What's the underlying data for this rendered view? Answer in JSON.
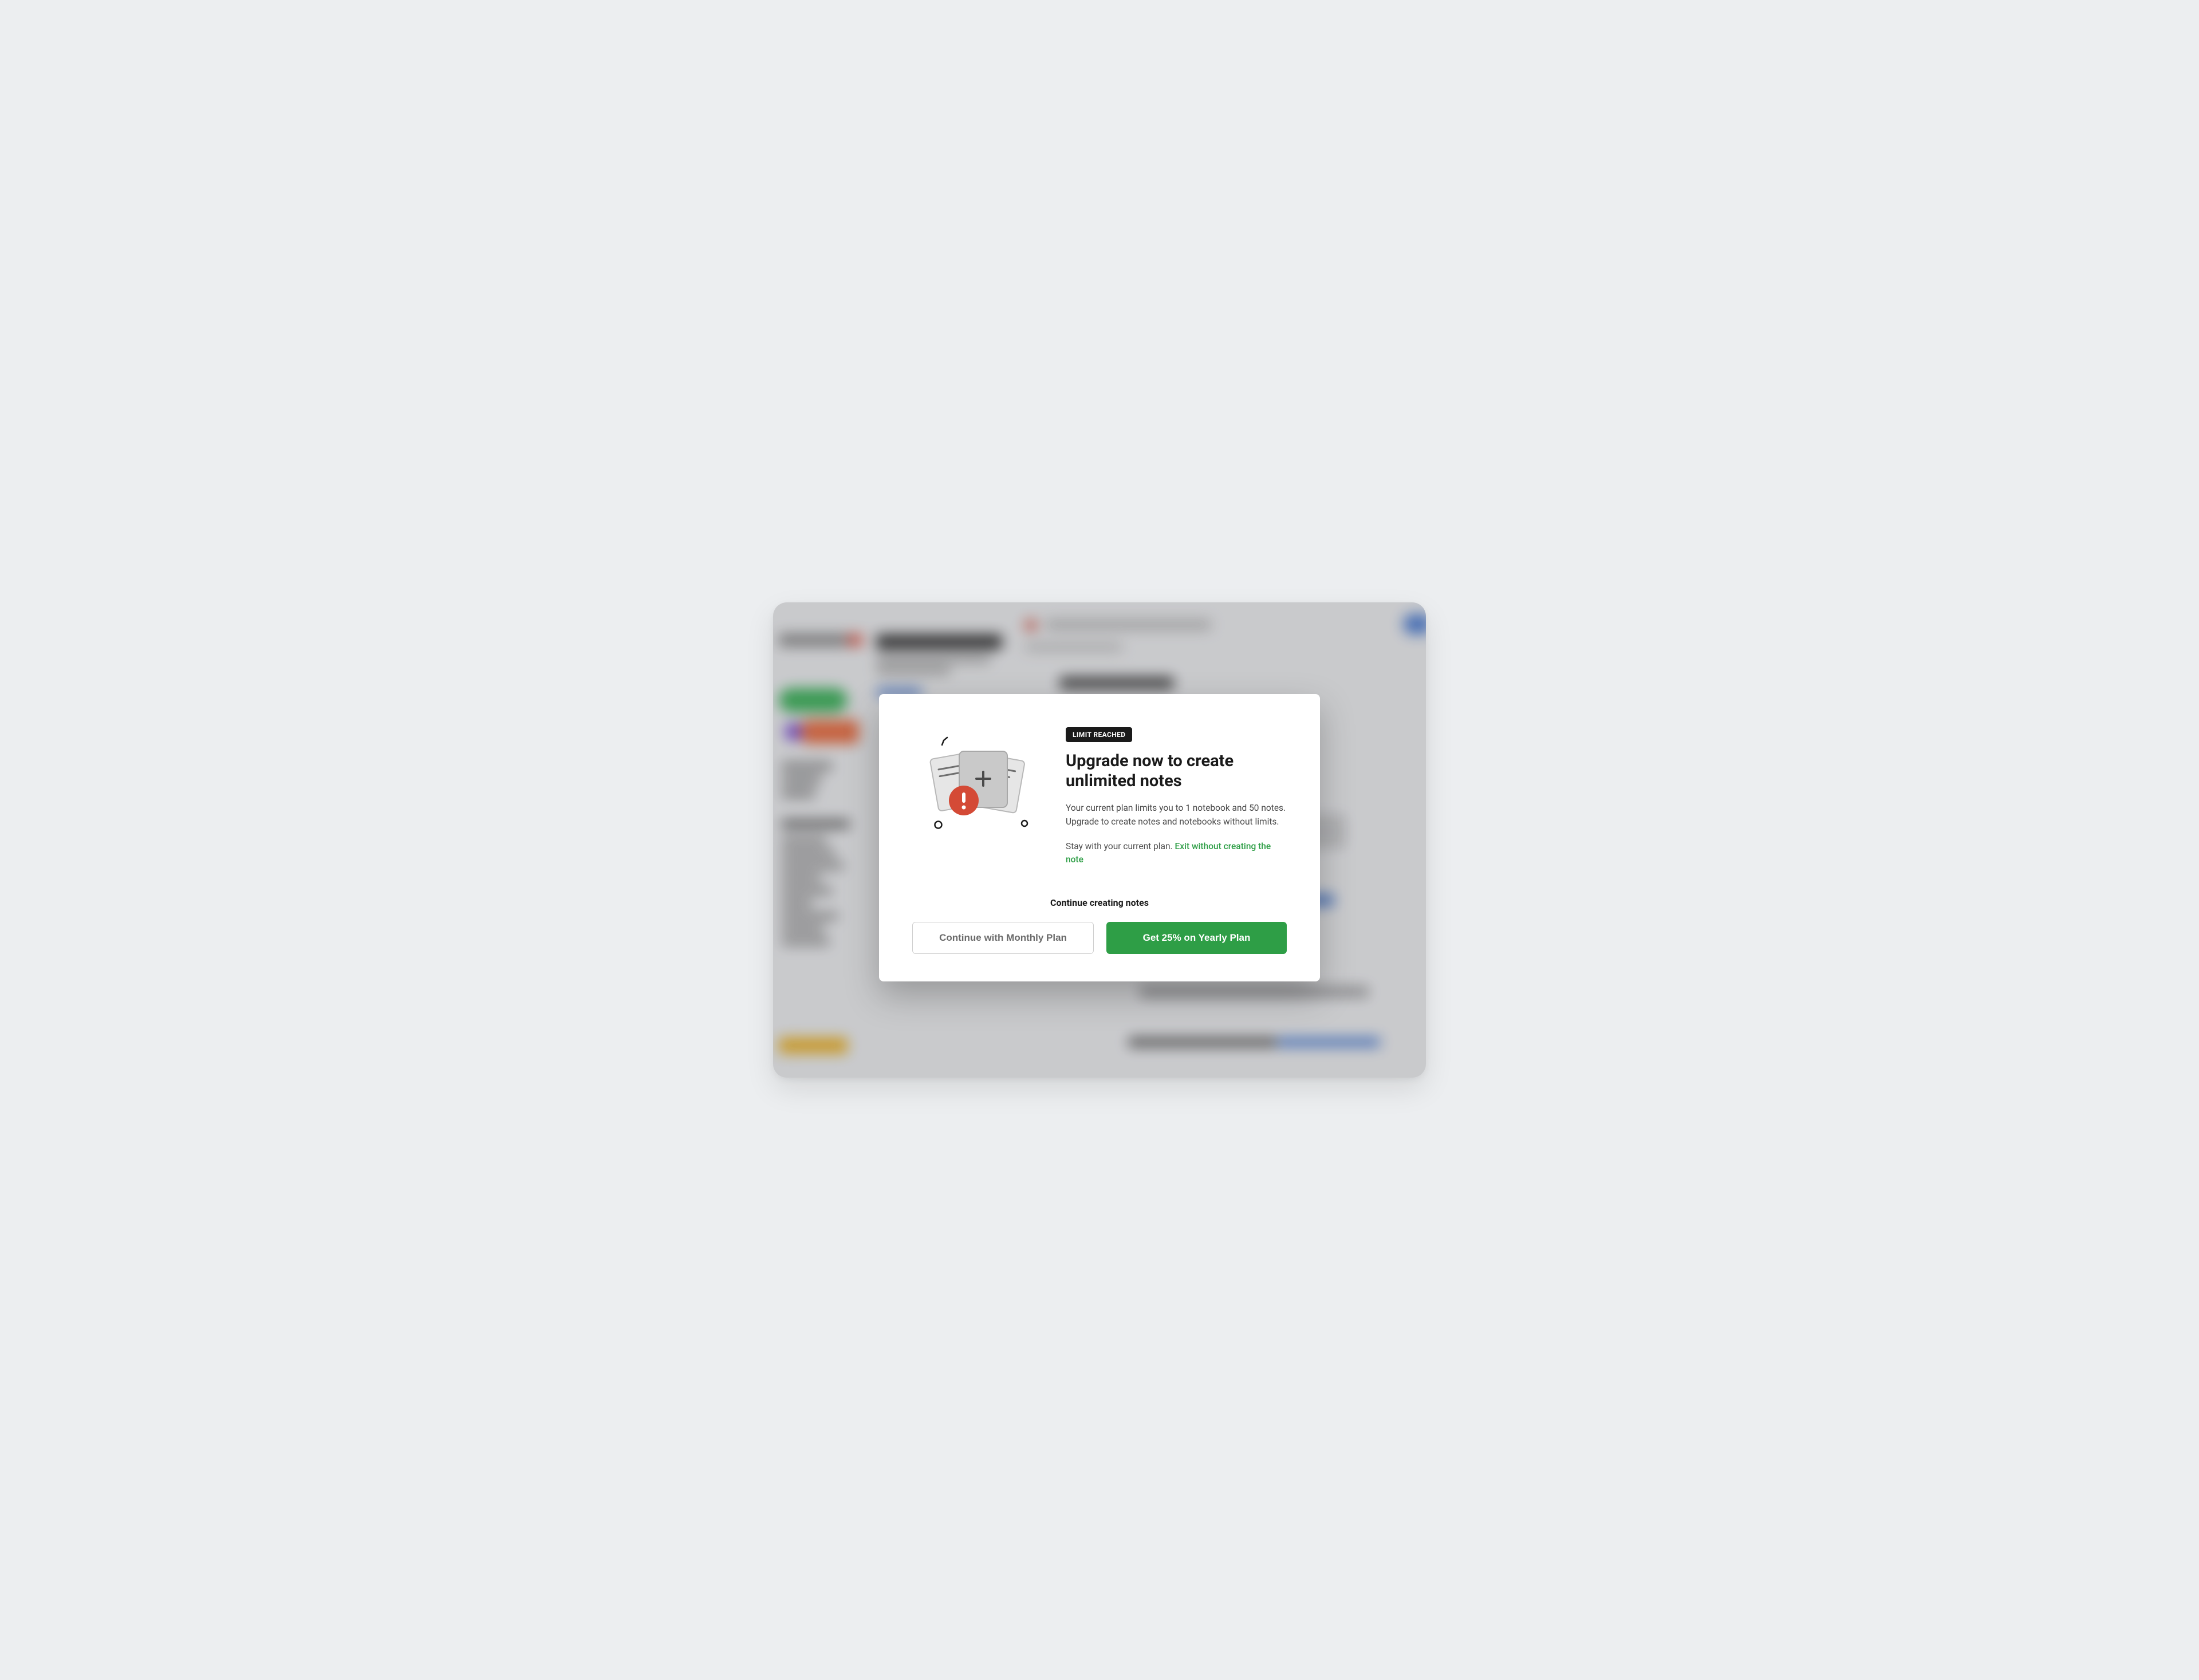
{
  "modal": {
    "badge": "LIMIT REACHED",
    "headline": "Upgrade now to create unlimited notes",
    "body": "Your current plan limits you to 1 notebook and 50 notes. Upgrade to create notes and notebooks without limits.",
    "stay_prefix": "Stay with your current plan. ",
    "exit_link": "Exit without creating the note",
    "continue_heading": "Continue creating notes",
    "monthly_button": "Continue with Monthly Plan",
    "yearly_button": "Get 25% on Yearly Plan"
  },
  "colors": {
    "accent_green": "#2e9e46",
    "badge_bg": "#1a1a1a",
    "alert_red": "#d44a36"
  }
}
